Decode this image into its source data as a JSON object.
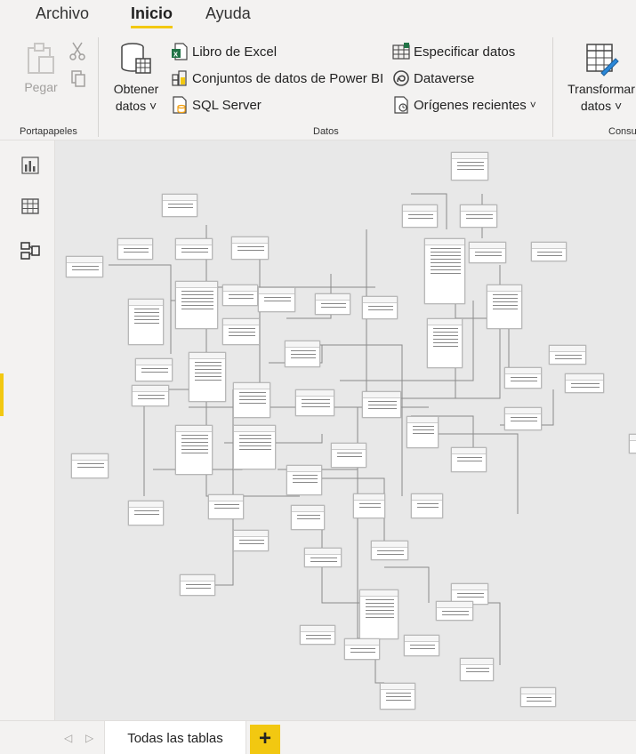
{
  "menu": {
    "tabs": [
      {
        "label": "Archivo"
      },
      {
        "label": "Inicio"
      },
      {
        "label": "Ayuda"
      }
    ]
  },
  "ribbon": {
    "clipboard": {
      "paste_label": "Pegar",
      "group_label": "Portapapeles"
    },
    "data": {
      "get_data_label_1": "Obtener",
      "get_data_label_2": "datos",
      "excel_label": "Libro de Excel",
      "powerbi_label": "Conjuntos de datos de Power BI",
      "sql_label": "SQL Server",
      "enter_data_label": "Especificar datos",
      "dataverse_label": "Dataverse",
      "recent_label": "Orígenes recientes",
      "group_label": "Datos"
    },
    "transform": {
      "label_1": "Transformar",
      "label_2": "datos",
      "group_label": "Consu"
    }
  },
  "bottom": {
    "page_tab_label": "Todas las tablas",
    "add_label": "+"
  },
  "colors": {
    "accent": "#f2c811",
    "ribbon_bg": "#f3f2f1",
    "canvas_bg": "#e8e8e8",
    "excel_green": "#217346"
  }
}
